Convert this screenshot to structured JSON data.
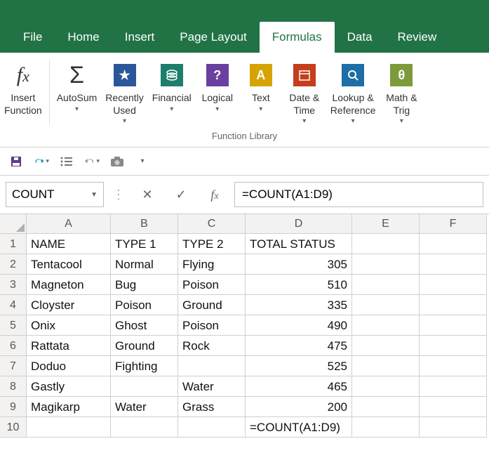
{
  "tabs": {
    "file": "File",
    "home": "Home",
    "insert": "Insert",
    "pagelayout": "Page Layout",
    "formulas": "Formulas",
    "data": "Data",
    "review": "Review"
  },
  "ribbon": {
    "insert_function": "Insert\nFunction",
    "autosum": "AutoSum",
    "recently": "Recently\nUsed",
    "financial": "Financial",
    "logical": "Logical",
    "text": "Text",
    "datetime": "Date &\nTime",
    "lookup": "Lookup &\nReference",
    "mathtrig": "Math &\nTrig",
    "group_label": "Function Library"
  },
  "namebox": "COUNT",
  "formula": "=COUNT(A1:D9)",
  "columns": [
    "A",
    "B",
    "C",
    "D",
    "E",
    "F"
  ],
  "rows": [
    "1",
    "2",
    "3",
    "4",
    "5",
    "6",
    "7",
    "8",
    "9",
    "10"
  ],
  "cells": {
    "r1": {
      "a": "NAME",
      "b": "TYPE 1",
      "c": "TYPE 2",
      "d": "TOTAL STATUS",
      "e": "",
      "f": ""
    },
    "r2": {
      "a": "Tentacool",
      "b": "Normal",
      "c": "Flying",
      "d": "305",
      "e": "",
      "f": ""
    },
    "r3": {
      "a": "Magneton",
      "b": "Bug",
      "c": "Poison",
      "d": "510",
      "e": "",
      "f": ""
    },
    "r4": {
      "a": "Cloyster",
      "b": "Poison",
      "c": "Ground",
      "d": "335",
      "e": "",
      "f": ""
    },
    "r5": {
      "a": "Onix",
      "b": "Ghost",
      "c": "Poison",
      "d": "490",
      "e": "",
      "f": ""
    },
    "r6": {
      "a": "Rattata",
      "b": "Ground",
      "c": "Rock",
      "d": "475",
      "e": "",
      "f": ""
    },
    "r7": {
      "a": "Doduo",
      "b": "Fighting",
      "c": "",
      "d": "525",
      "e": "",
      "f": ""
    },
    "r8": {
      "a": "Gastly",
      "b": "",
      "c": "Water",
      "d": "465",
      "e": "",
      "f": ""
    },
    "r9": {
      "a": "Magikarp",
      "b": "Water",
      "c": "Grass",
      "d": "200",
      "e": "",
      "f": ""
    },
    "r10": {
      "a": "",
      "b": "",
      "c": "",
      "d": "=COUNT(A1:D9)",
      "e": "",
      "f": ""
    }
  },
  "chart_data": {
    "type": "table",
    "title": "",
    "columns": [
      "NAME",
      "TYPE 1",
      "TYPE 2",
      "TOTAL STATUS"
    ],
    "rows": [
      [
        "Tentacool",
        "Normal",
        "Flying",
        305
      ],
      [
        "Magneton",
        "Bug",
        "Poison",
        510
      ],
      [
        "Cloyster",
        "Poison",
        "Ground",
        335
      ],
      [
        "Onix",
        "Ghost",
        "Poison",
        490
      ],
      [
        "Rattata",
        "Ground",
        "Rock",
        475
      ],
      [
        "Doduo",
        "Fighting",
        "",
        525
      ],
      [
        "Gastly",
        "",
        "Water",
        465
      ],
      [
        "Magikarp",
        "Water",
        "Grass",
        200
      ]
    ]
  }
}
